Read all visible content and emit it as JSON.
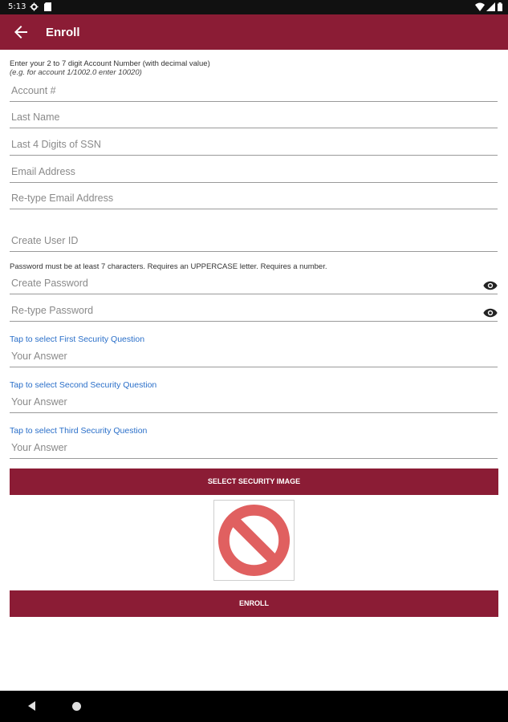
{
  "status_bar": {
    "time": "5:13"
  },
  "app_bar": {
    "title": "Enroll"
  },
  "account_hint": {
    "line1": "Enter your 2 to 7 digit Account Number (with decimal value)",
    "line2": "(e.g. for account 1/1002.0 enter 10020)"
  },
  "fields": {
    "account": {
      "placeholder": "Account #"
    },
    "last_name": {
      "placeholder": "Last Name"
    },
    "ssn": {
      "placeholder": "Last 4 Digits of SSN"
    },
    "email": {
      "placeholder": "Email Address"
    },
    "email_confirm": {
      "placeholder": "Re-type Email Address"
    },
    "user_id": {
      "placeholder": "Create User ID"
    },
    "password": {
      "placeholder": "Create Password"
    },
    "password_confirm": {
      "placeholder": "Re-type Password"
    },
    "answer1": {
      "placeholder": "Your Answer"
    },
    "answer2": {
      "placeholder": "Your Answer"
    },
    "answer3": {
      "placeholder": "Your Answer"
    }
  },
  "password_hint": "Password must be at least 7 characters. Requires an UPPERCASE letter. Requires a number.",
  "security_questions": {
    "first": "Tap to select First Security Question",
    "second": "Tap to select Second Security Question",
    "third": "Tap to select Third Security Question"
  },
  "buttons": {
    "select_image": "SELECT SECURITY IMAGE",
    "enroll": "ENROLL"
  },
  "icons": {
    "back": "arrow-left-icon",
    "eye": "eye-icon",
    "no_image": "prohibited-icon"
  },
  "colors": {
    "brand": "#8b1c35",
    "link": "#2a6fc9",
    "prohibited": "#e06060"
  }
}
